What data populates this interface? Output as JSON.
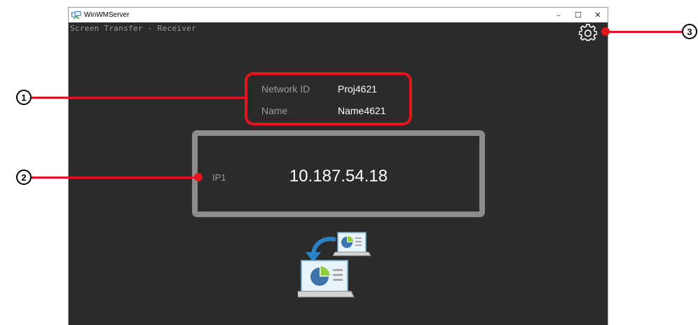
{
  "window": {
    "title": "WinWMServer",
    "controls": {
      "minimize": "–",
      "maximize": "☐",
      "close": "✕"
    }
  },
  "app": {
    "subtitle": "Screen Transfer - Receiver",
    "network_id_label": "Network ID",
    "network_id_value": "Proj4621",
    "name_label": "Name",
    "name_value": "Name4621",
    "ip_label": "IP1",
    "ip_value": "10.187.54.18",
    "settings_icon": "gear-icon",
    "transfer_icon": "screen-transfer-icon"
  },
  "callouts": [
    "1",
    "2",
    "3"
  ],
  "colors": {
    "annotation": "#e3141b",
    "window_bg": "#2b2b2b",
    "ip_frame": "#8c8c8c",
    "label_text": "#9c9c9c"
  }
}
